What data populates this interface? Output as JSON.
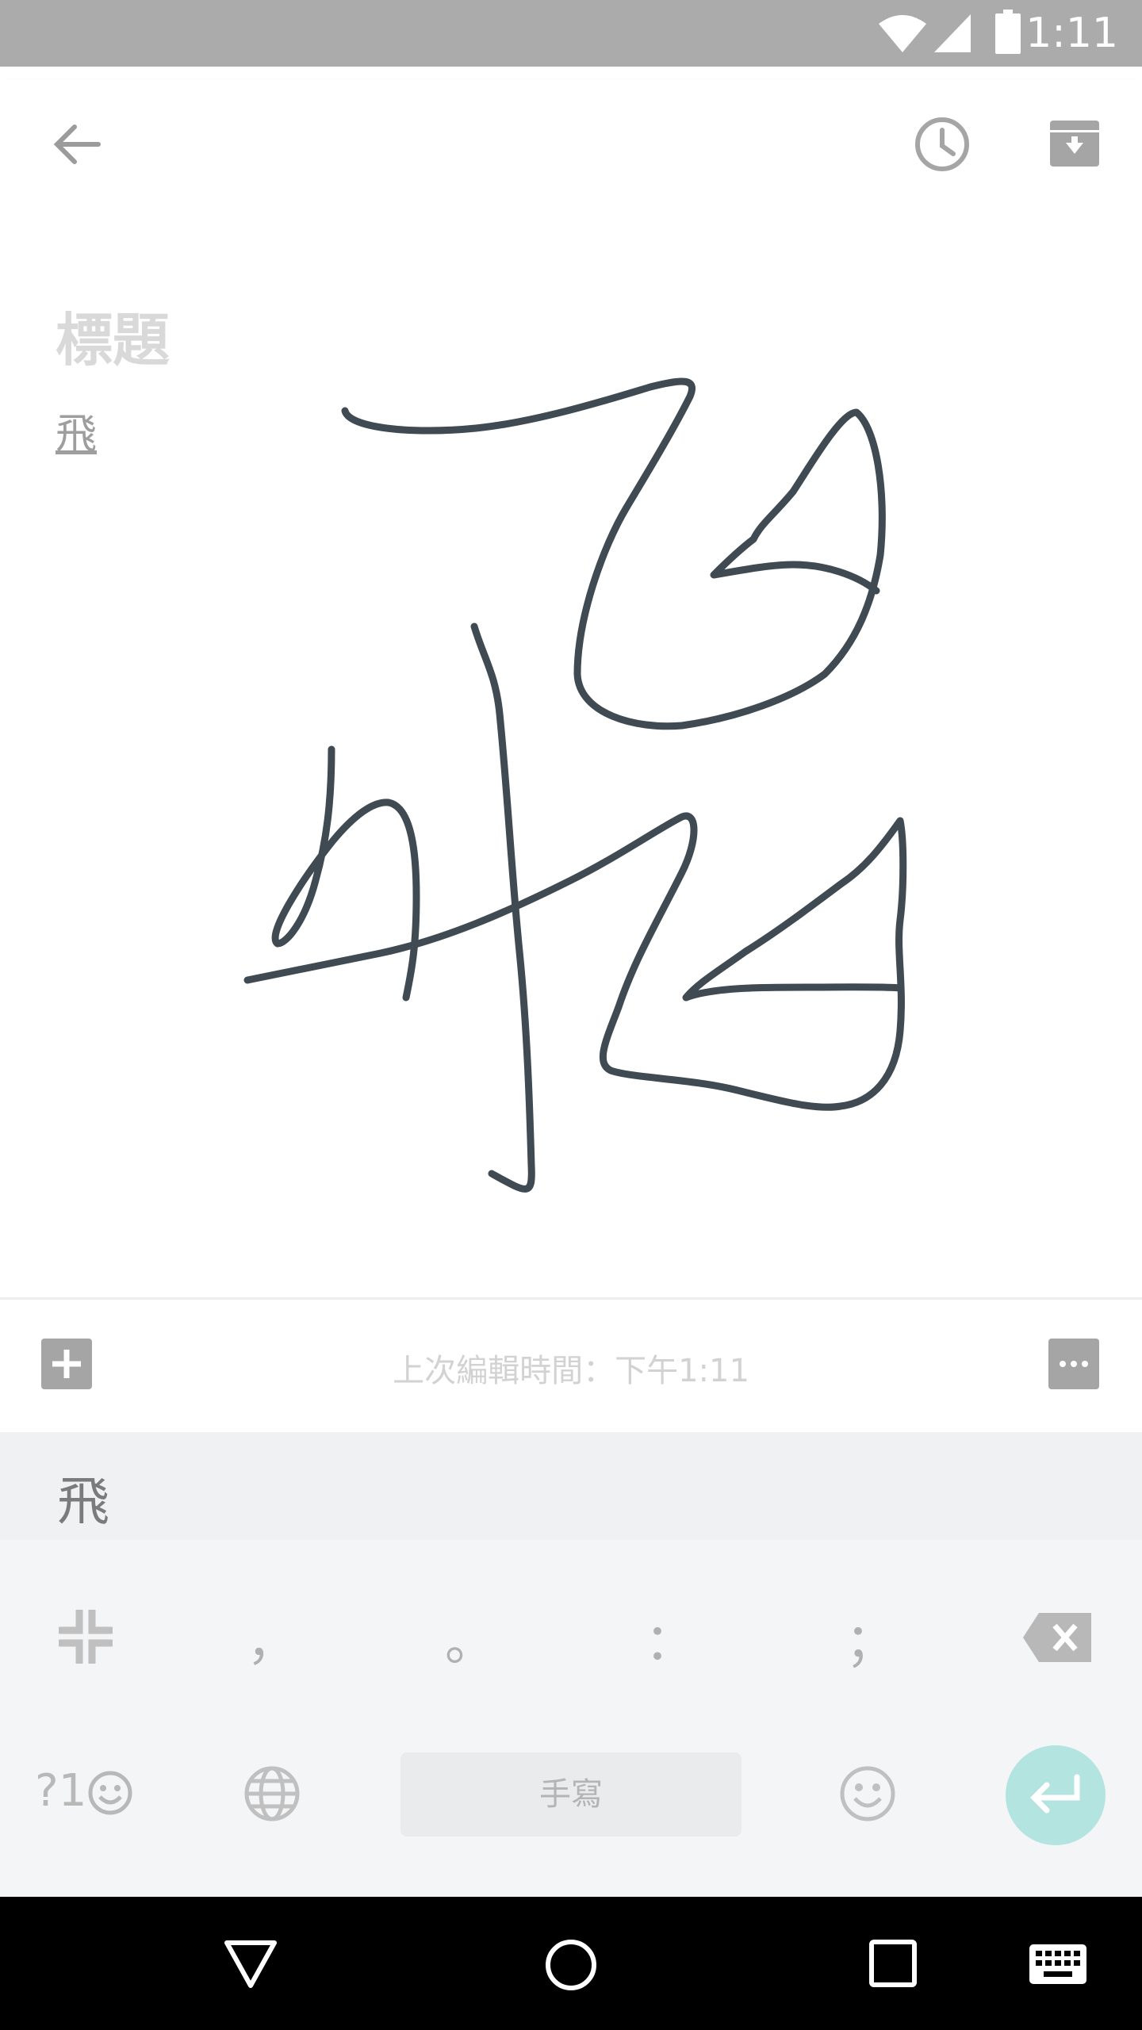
{
  "status_bar": {
    "time": "1:11"
  },
  "note": {
    "title_placeholder": "標題",
    "body_text": "飛"
  },
  "footer": {
    "edited_text": "上次編輯時間：下午1:11"
  },
  "keyboard": {
    "candidate": "飛",
    "punctuation": [
      "，",
      "。",
      "：",
      "；"
    ],
    "symbols_label": "?1",
    "space_label": "手寫"
  },
  "colors": {
    "ink": "#3a4750",
    "accent_enter": "#b3e4df",
    "status_bar": "#ababab"
  }
}
